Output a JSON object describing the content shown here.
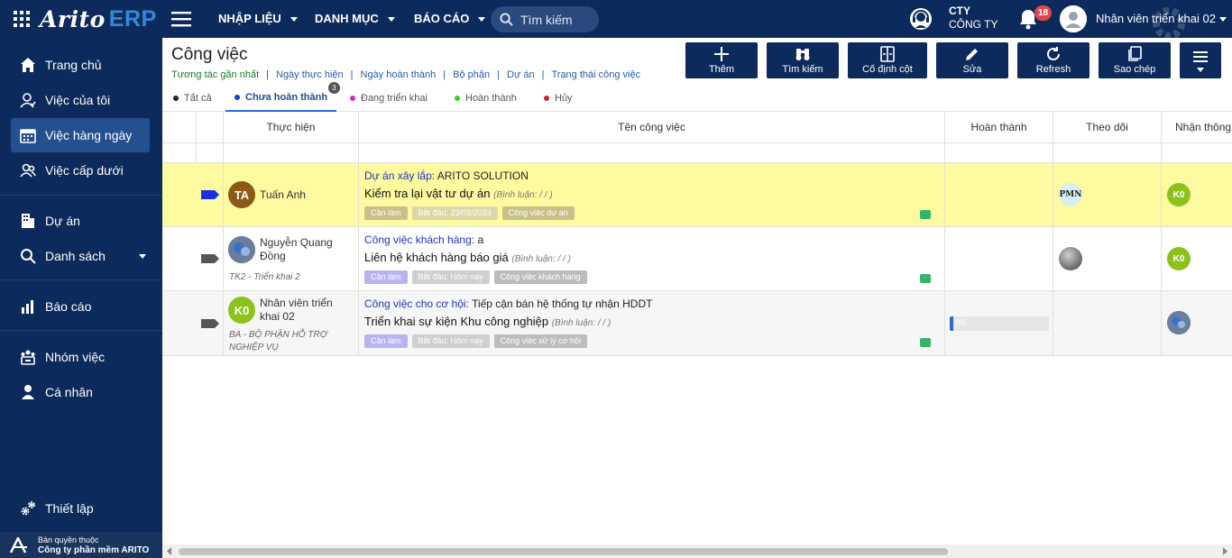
{
  "app": {
    "logo": "Arito",
    "logo_suffix": "ERP"
  },
  "topnav": {
    "menus": [
      "NHẬP LIỆU",
      "DANH MỤC",
      "BÁO CÁO"
    ],
    "search_placeholder": "Tìm kiếm",
    "company_line1": "CTY",
    "company_line2": "CÔNG TY",
    "notification_count": "18",
    "user_name": "Nhân viên triển khai 02"
  },
  "sidebar": {
    "items": [
      {
        "label": "Trang chủ",
        "icon": "home-icon"
      },
      {
        "label": "Việc của tôi",
        "icon": "user-icon"
      },
      {
        "label": "Việc hàng ngày",
        "icon": "calendar-icon",
        "active": true
      },
      {
        "label": "Việc cấp dưới",
        "icon": "users-icon"
      },
      {
        "label": "Dự án",
        "icon": "building-icon"
      },
      {
        "label": "Danh sách",
        "icon": "search-icon"
      },
      {
        "label": "Báo cáo",
        "icon": "chart-icon"
      },
      {
        "label": "Nhóm việc",
        "icon": "group-icon"
      },
      {
        "label": "Cá nhân",
        "icon": "person-icon"
      },
      {
        "label": "Thiết lập",
        "icon": "gears-icon"
      }
    ],
    "copyright_line1": "Bản quyền thuộc",
    "copyright_line2": "Công ty phần mềm ARITO"
  },
  "page": {
    "title": "Công việc",
    "filters": [
      "Tương tác gần nhất",
      "Ngày thực hiện",
      "Ngày hoàn thành",
      "Bộ phận",
      "Dự án",
      "Trạng thái công việc"
    ],
    "toolbar": [
      "Thêm",
      "Tìm kiếm",
      "Cố định cột",
      "Sửa",
      "Refresh",
      "Sao chép"
    ]
  },
  "tabs": [
    {
      "label": "Tất cả",
      "color": "#222222"
    },
    {
      "label": "Chưa hoàn thành",
      "color": "#1a3fc7",
      "active": true,
      "count": "3"
    },
    {
      "label": "Đang triển khai",
      "color": "#e21fd0"
    },
    {
      "label": "Hoàn thành",
      "color": "#2fd12f"
    },
    {
      "label": "Hủy",
      "color": "#d41f1f"
    }
  ],
  "table": {
    "headers": [
      "Thực hiện",
      "Tên công việc",
      "Hoàn thành",
      "Theo dõi",
      "Nhận thông"
    ],
    "rows": [
      {
        "assignee_initials": "TA",
        "assignee_name": "Tuấn Anh",
        "assignee_sub": "",
        "category_label": "Dự án xây lắp:",
        "category_value": "ARITO SOLUTION",
        "task_name": "Kiểm tra lại vật tư dự án",
        "comment_note": "(Bình luận:   / /   )",
        "chips": [
          "Cần làm",
          "Bắt đầu: 23/03/2023",
          "Công việc dự án"
        ],
        "progress": null,
        "follower": "PMN",
        "receiver": "K0"
      },
      {
        "assignee_initials": "",
        "assignee_name": "Nguyễn Quang Đồng",
        "assignee_sub": "TK2 - Triển khai 2",
        "category_label": "Công việc khách hàng:",
        "category_value": "a",
        "task_name": "Liên hệ khách hàng báo giá",
        "comment_note": "(Bình luận:   / /   )",
        "chips": [
          "Cần làm",
          "Bắt đầu: Hôm nay",
          "Công việc khách hàng"
        ],
        "progress": null,
        "follower": "",
        "receiver": "K0"
      },
      {
        "assignee_initials": "K0",
        "assignee_name": "Nhân viên triển khai 02",
        "assignee_sub": "BA - BỘ PHẬN HỖ TRỢ NGHIỆP VỤ",
        "category_label": "Công việc cho cơ hội:",
        "category_value": "Tiếp cận bán hệ thống tự nhận HDDT",
        "task_name": "Triển khai sự kiện Khu công nghiệp",
        "comment_note": "(Bình luận:   / /   )",
        "chips": [
          "Cần làm",
          "Bắt đầu: Hôm nay",
          "Công việc xử lý cơ hội"
        ],
        "progress": "0%",
        "follower": "",
        "receiver": ""
      }
    ]
  }
}
